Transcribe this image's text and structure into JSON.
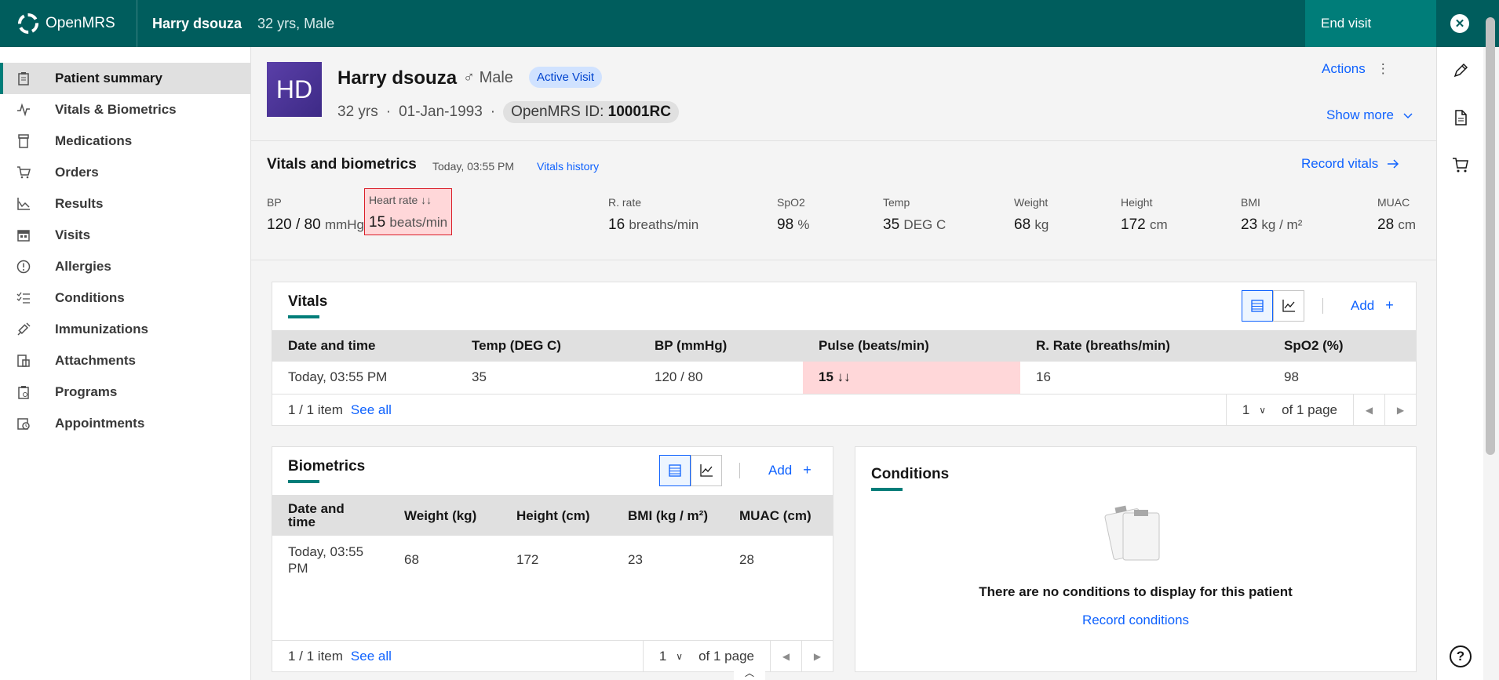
{
  "topbar": {
    "brand": "OpenMRS",
    "patient_name": "Harry dsouza",
    "patient_meta": "32 yrs, Male",
    "end_visit_label": "End visit",
    "close_icon": "close-icon"
  },
  "sidebar": {
    "items": [
      {
        "label": "Patient summary",
        "icon": "clipboard-icon"
      },
      {
        "label": "Vitals & Biometrics",
        "icon": "activity-icon"
      },
      {
        "label": "Medications",
        "icon": "pill-bottle-icon"
      },
      {
        "label": "Orders",
        "icon": "cart-icon"
      },
      {
        "label": "Results",
        "icon": "chart-icon"
      },
      {
        "label": "Visits",
        "icon": "calendar-icon"
      },
      {
        "label": "Allergies",
        "icon": "warning-icon"
      },
      {
        "label": "Conditions",
        "icon": "checklist-icon"
      },
      {
        "label": "Immunizations",
        "icon": "syringe-icon"
      },
      {
        "label": "Attachments",
        "icon": "attachment-icon"
      },
      {
        "label": "Programs",
        "icon": "program-icon"
      },
      {
        "label": "Appointments",
        "icon": "appointment-icon"
      }
    ]
  },
  "header": {
    "initials": "HD",
    "name": "Harry dsouza",
    "gender_symbol": "♂",
    "gender": "Male",
    "visit_badge": "Active Visit",
    "age": "32 yrs",
    "dob": "01-Jan-1993",
    "id_label": "OpenMRS ID:",
    "id_value": "10001RC",
    "actions_label": "Actions",
    "show_more_label": "Show more"
  },
  "vitals_header": {
    "title": "Vitals and biometrics",
    "time": "Today, 03:55 PM",
    "history_link": "Vitals history",
    "record_label": "Record vitals",
    "tiles": [
      {
        "label": "BP",
        "value": "120 / 80",
        "unit": "mmHg"
      },
      {
        "label": "Heart rate ↓↓",
        "value": "15",
        "unit": "beats/min"
      },
      {
        "label": "R. rate",
        "value": "16",
        "unit": "breaths/min"
      },
      {
        "label": "SpO2",
        "value": "98",
        "unit": "%"
      },
      {
        "label": "Temp",
        "value": "35",
        "unit": "DEG C"
      },
      {
        "label": "Weight",
        "value": "68",
        "unit": "kg"
      },
      {
        "label": "Height",
        "value": "172",
        "unit": "cm"
      },
      {
        "label": "BMI",
        "value": "23",
        "unit": "kg / m²"
      },
      {
        "label": "MUAC",
        "value": "28",
        "unit": "cm"
      }
    ]
  },
  "vitals_card": {
    "title": "Vitals",
    "add_label": "Add",
    "columns": [
      "Date and time",
      "Temp (DEG C)",
      "BP (mmHg)",
      "Pulse (beats/min)",
      "R. Rate (breaths/min)",
      "SpO2 (%)"
    ],
    "rows": [
      [
        "Today, 03:55 PM",
        "35",
        "120 / 80",
        "15 ↓↓",
        "16",
        "98"
      ]
    ],
    "count": "1 / 1 item",
    "see_all": "See all",
    "page": "1",
    "of_pages": "of 1 page"
  },
  "biometrics_card": {
    "title": "Biometrics",
    "add_label": "Add",
    "columns": [
      "Date and time",
      "Weight (kg)",
      "Height (cm)",
      "BMI (kg / m²)",
      "MUAC (cm)"
    ],
    "rows": [
      [
        "Today, 03:55 PM",
        "68",
        "172",
        "23",
        "28"
      ]
    ],
    "count": "1 / 1 item",
    "see_all": "See all",
    "page": "1",
    "of_pages": "of 1 page"
  },
  "conditions_card": {
    "title": "Conditions",
    "empty_message": "There are no conditions to display for this patient",
    "record_link": "Record conditions"
  },
  "rail": {
    "help_label": "?"
  }
}
